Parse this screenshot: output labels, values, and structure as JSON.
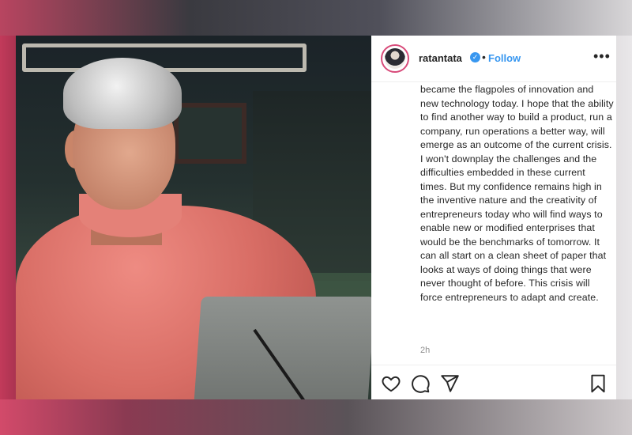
{
  "post": {
    "username": "ratantata",
    "verified_badge": "✓",
    "dot": "•",
    "follow_label": "Follow",
    "more_label": "•••",
    "caption": "became the flagpoles of innovation and new technology today. I hope that the ability to find another way to build a product, run a company, run operations a better way, will emerge as an outcome of the current crisis. I won't downplay the challenges and the difficulties embedded in these current times. But my confidence remains high in the inventive nature and the creativity of entrepreneurs today who will find ways to enable new or modified enterprises that would be the benchmarks of tomorrow. It can all start on a clean sheet of paper that looks at ways of doing things that were never thought of before. This crisis will force entrepreneurs to adapt and create.",
    "time": "2h"
  },
  "icons": {
    "like": "heart-icon",
    "comment": "comment-icon",
    "share": "share-icon",
    "save": "bookmark-icon",
    "verified": "verified-icon",
    "more": "more-icon"
  },
  "colors": {
    "accent": "#3897f0",
    "text": "#262626",
    "muted": "#8e8e8e",
    "avatar_ring": "#d84b7a"
  }
}
